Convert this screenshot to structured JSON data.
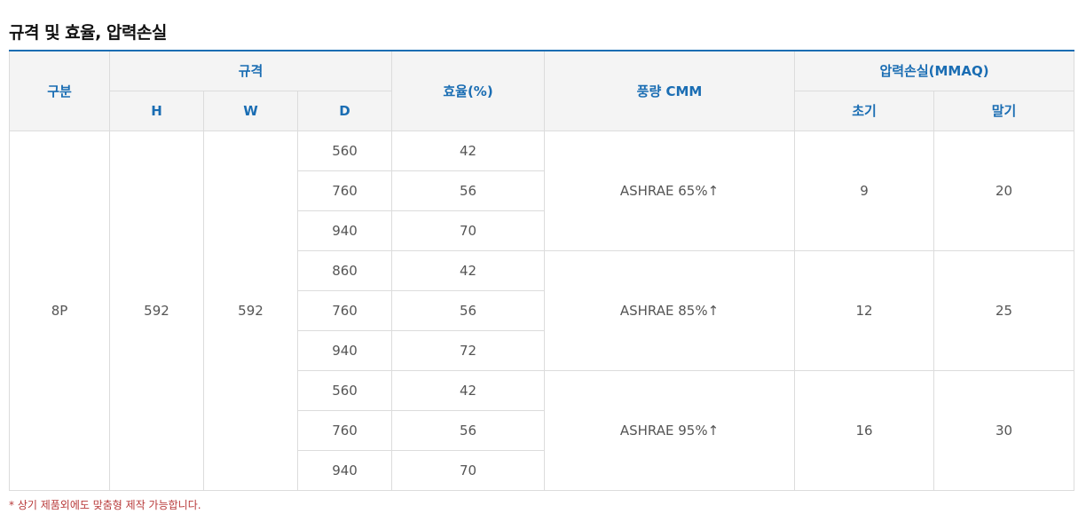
{
  "title": "규격 및 효율, 압력손실",
  "headers": {
    "category": "구분",
    "spec": "규격",
    "h": "H",
    "w": "W",
    "d": "D",
    "efficiency": "효율(%)",
    "airflow": "풍량 CMM",
    "pressure_loss": "압력손실(MMAQ)",
    "initial": "초기",
    "final": "말기"
  },
  "row": {
    "category": "8P",
    "h": "592",
    "w": "592"
  },
  "groups": [
    {
      "rows": [
        {
          "d": "560",
          "eff": "42"
        },
        {
          "d": "760",
          "eff": "56"
        },
        {
          "d": "940",
          "eff": "70"
        }
      ],
      "airflow": "ASHRAE 65%↑",
      "initial": "9",
      "final": "20"
    },
    {
      "rows": [
        {
          "d": "860",
          "eff": "42"
        },
        {
          "d": "760",
          "eff": "56"
        },
        {
          "d": "940",
          "eff": "72"
        }
      ],
      "airflow": "ASHRAE 85%↑",
      "initial": "12",
      "final": "25"
    },
    {
      "rows": [
        {
          "d": "560",
          "eff": "42"
        },
        {
          "d": "760",
          "eff": "56"
        },
        {
          "d": "940",
          "eff": "70"
        }
      ],
      "airflow": "ASHRAE 95%↑",
      "initial": "16",
      "final": "30"
    }
  ],
  "note": "* 상기 제품외에도 맞춤형 제작 가능합니다.",
  "colors": {
    "accent": "#1a6db3",
    "header_bg": "#f4f4f4",
    "border": "#dcdcdc",
    "note": "#b83a3a"
  }
}
